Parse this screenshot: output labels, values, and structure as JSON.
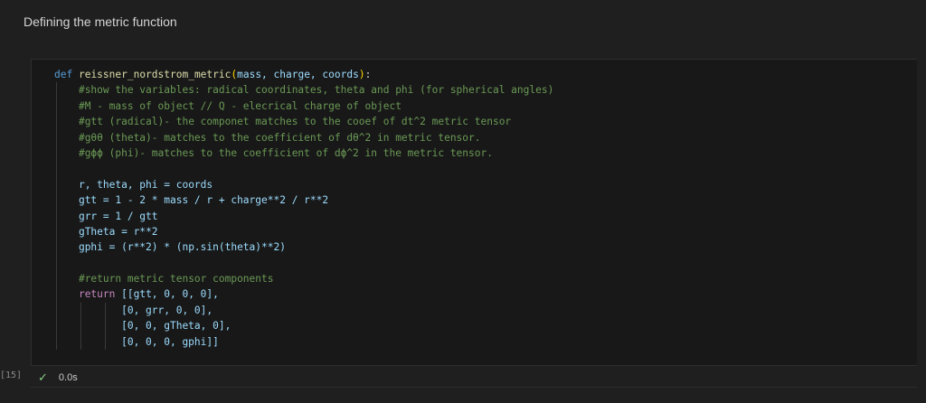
{
  "markdown": {
    "heading": "Defining the metric function"
  },
  "cell": {
    "execution_count": "[15]",
    "status_icon": "check-icon",
    "duration": "0.0s",
    "code": {
      "def_kw": "def",
      "fn_name": "reissner_nordstrom_metric",
      "params": "mass, charge, coords",
      "comment1": "#show the variables: radical coordinates, theta and phi (for spherical angles)",
      "comment2": "#M - mass of object // Q - elecrical charge of object",
      "comment3": "#gtt (radical)- the componet matches to the cooef of dt^2 metric tensor",
      "comment4": "#gθθ (theta)- matches to the coefficient of dθ^2 in metric tensor.",
      "comment5": "#gϕϕ (phi)- matches to the coefficient of dϕ^2 in the metric tensor.",
      "line_unpack": "r, theta, phi = coords",
      "line_gtt": "gtt = 1 - 2 * mass / r + charge**2 / r**2",
      "line_grr": "grr = 1 / gtt",
      "line_gtheta": "gTheta = r**2",
      "line_gphi": "gphi = (r**2) * (np.sin(theta)**2)",
      "comment_return": "#return metric tensor components",
      "return_kw": "return",
      "row1": "[[gtt, 0, 0, 0],",
      "row2": "[0, grr, 0, 0],",
      "row3": "[0, 0, gTheta, 0],",
      "row4": "[0, 0, 0, gphi]]"
    }
  },
  "colors": {
    "background": "#1f1f1f",
    "cell_background": "#181818",
    "keyword": "#569cd6",
    "function": "#dcdcaa",
    "comment": "#6a9955",
    "success": "#89d185"
  }
}
